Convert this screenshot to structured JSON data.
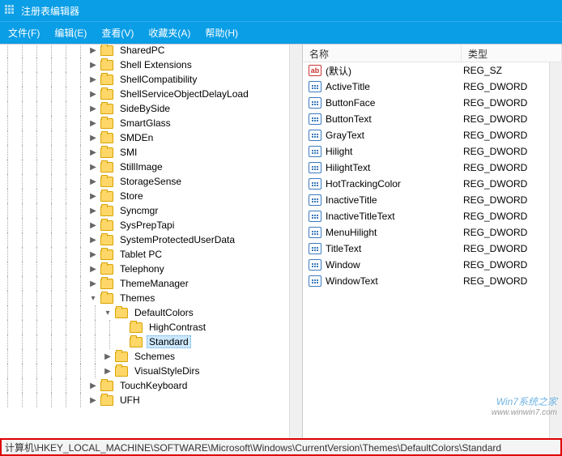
{
  "window": {
    "title": "注册表编辑器"
  },
  "menu": {
    "file": "文件(F)",
    "edit": "编辑(E)",
    "view": "查看(V)",
    "fav": "收藏夹(A)",
    "help": "帮助(H)"
  },
  "tree": [
    {
      "depth": 6,
      "expander": ">",
      "label": "SharedPC"
    },
    {
      "depth": 6,
      "expander": ">",
      "label": "Shell Extensions"
    },
    {
      "depth": 6,
      "expander": ">",
      "label": "ShellCompatibility"
    },
    {
      "depth": 6,
      "expander": ">",
      "label": "ShellServiceObjectDelayLoad"
    },
    {
      "depth": 6,
      "expander": ">",
      "label": "SideBySide"
    },
    {
      "depth": 6,
      "expander": ">",
      "label": "SmartGlass"
    },
    {
      "depth": 6,
      "expander": ">",
      "label": "SMDEn"
    },
    {
      "depth": 6,
      "expander": ">",
      "label": "SMI"
    },
    {
      "depth": 6,
      "expander": ">",
      "label": "StillImage"
    },
    {
      "depth": 6,
      "expander": ">",
      "label": "StorageSense"
    },
    {
      "depth": 6,
      "expander": ">",
      "label": "Store"
    },
    {
      "depth": 6,
      "expander": ">",
      "label": "Syncmgr"
    },
    {
      "depth": 6,
      "expander": ">",
      "label": "SysPrepTapi"
    },
    {
      "depth": 6,
      "expander": ">",
      "label": "SystemProtectedUserData"
    },
    {
      "depth": 6,
      "expander": ">",
      "label": "Tablet PC"
    },
    {
      "depth": 6,
      "expander": ">",
      "label": "Telephony"
    },
    {
      "depth": 6,
      "expander": ">",
      "label": "ThemeManager"
    },
    {
      "depth": 6,
      "expander": "v",
      "label": "Themes"
    },
    {
      "depth": 7,
      "expander": "v",
      "label": "DefaultColors"
    },
    {
      "depth": 8,
      "expander": "",
      "label": "HighContrast"
    },
    {
      "depth": 8,
      "expander": "",
      "label": "Standard",
      "selected": true
    },
    {
      "depth": 7,
      "expander": ">",
      "label": "Schemes"
    },
    {
      "depth": 7,
      "expander": ">",
      "label": "VisualStyleDirs"
    },
    {
      "depth": 6,
      "expander": ">",
      "label": "TouchKeyboard"
    },
    {
      "depth": 6,
      "expander": ">",
      "label": "UFH"
    }
  ],
  "columns": {
    "name": "名称",
    "type": "类型"
  },
  "values": [
    {
      "icon": "ab",
      "name": "(默认)",
      "type": "REG_SZ"
    },
    {
      "icon": "dw",
      "name": "ActiveTitle",
      "type": "REG_DWORD"
    },
    {
      "icon": "dw",
      "name": "ButtonFace",
      "type": "REG_DWORD"
    },
    {
      "icon": "dw",
      "name": "ButtonText",
      "type": "REG_DWORD"
    },
    {
      "icon": "dw",
      "name": "GrayText",
      "type": "REG_DWORD"
    },
    {
      "icon": "dw",
      "name": "Hilight",
      "type": "REG_DWORD"
    },
    {
      "icon": "dw",
      "name": "HilightText",
      "type": "REG_DWORD"
    },
    {
      "icon": "dw",
      "name": "HotTrackingColor",
      "type": "REG_DWORD"
    },
    {
      "icon": "dw",
      "name": "InactiveTitle",
      "type": "REG_DWORD"
    },
    {
      "icon": "dw",
      "name": "InactiveTitleText",
      "type": "REG_DWORD"
    },
    {
      "icon": "dw",
      "name": "MenuHilight",
      "type": "REG_DWORD"
    },
    {
      "icon": "dw",
      "name": "TitleText",
      "type": "REG_DWORD"
    },
    {
      "icon": "dw",
      "name": "Window",
      "type": "REG_DWORD"
    },
    {
      "icon": "dw",
      "name": "WindowText",
      "type": "REG_DWORD"
    }
  ],
  "statusbar": "计算机\\HKEY_LOCAL_MACHINE\\SOFTWARE\\Microsoft\\Windows\\CurrentVersion\\Themes\\DefaultColors\\Standard",
  "watermark": {
    "line1": "Win7系统之家",
    "line2": "www.winwin7.com"
  }
}
